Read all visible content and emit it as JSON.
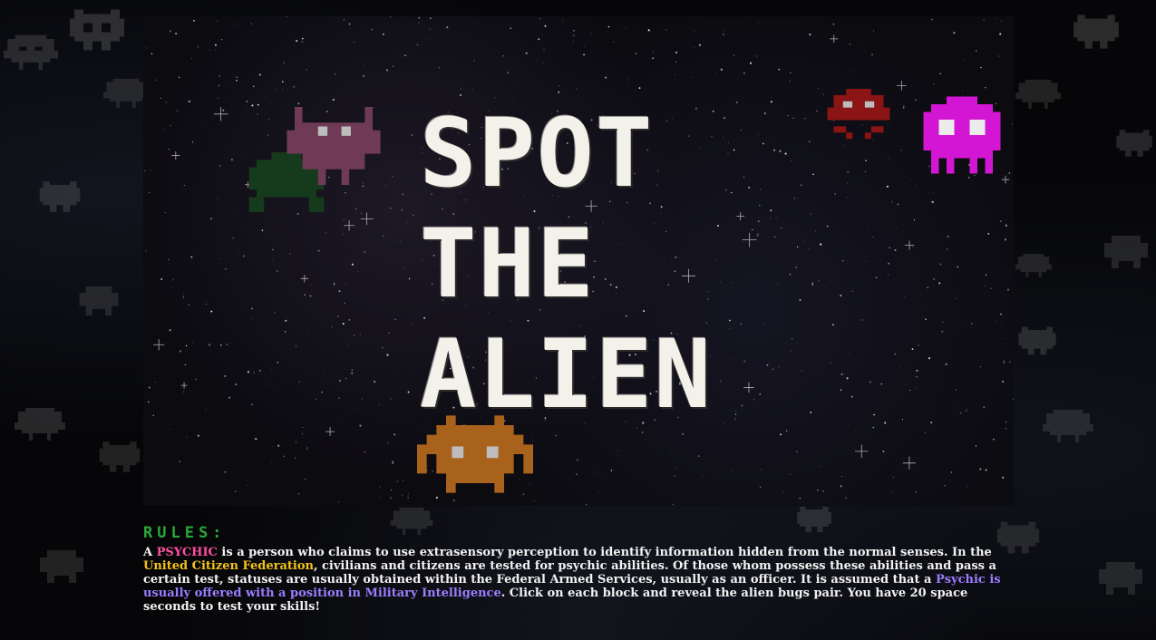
{
  "hero": {
    "title_lines": [
      "SPOT",
      "THE",
      "ALIEN"
    ]
  },
  "rules": {
    "heading": "RULES:",
    "p1": "A ",
    "psychic": "PSYCHIC",
    "p2": " is a person who claims to use extrasensory perception to identify information hidden from the normal senses. In the ",
    "federation": "United Citizen Federation",
    "p3": ", civilians and citizens are tested for psychic abilities. Of those whom possess these abilities and pass a certain test, statuses are usually obtained within the Federal Armed Services, usually as an officer. It is assumed that a ",
    "intel": "Psychic is usually offered with a position in Military Intelligence",
    "p4": ". Click on each block and reveal the alien bugs pair. You have 20 space seconds to test your skills!"
  },
  "colors": {
    "rules_heading": "#2aa83a",
    "psychic": "#ff4fa3",
    "federation": "#f3c21b",
    "intel": "#9b7dff",
    "invader_magenta": "#d316d3",
    "invader_red": "#8b1414",
    "invader_brown": "#a8621c",
    "invader_rose": "#6e3a55",
    "invader_green": "#163a1c"
  },
  "icons": {
    "invaders": [
      "alien-invader-icon"
    ]
  }
}
